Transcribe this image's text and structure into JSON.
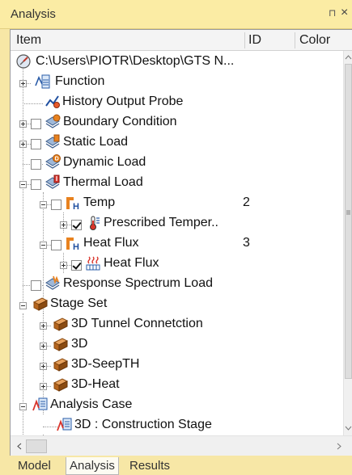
{
  "panel": {
    "title": "Analysis",
    "pin_glyph": "⊓",
    "close_glyph": "×"
  },
  "columns": {
    "item": "Item",
    "id": "ID",
    "color": "Color"
  },
  "tree": [
    {
      "label": "C:\\Users\\PIOTR\\Desktop\\GTS N...",
      "id": "",
      "icon": "project-icon"
    },
    {
      "label": "Function",
      "id": "",
      "icon": "function-icon"
    },
    {
      "label": "History Output Probe",
      "id": "",
      "icon": "history-output-probe-icon"
    },
    {
      "label": "Boundary Condition",
      "id": "",
      "icon": "boundary-condition-icon",
      "checked": false
    },
    {
      "label": "Static Load",
      "id": "",
      "icon": "static-load-icon",
      "checked": false
    },
    {
      "label": "Dynamic Load",
      "id": "",
      "icon": "dynamic-load-icon",
      "checked": false
    },
    {
      "label": "Thermal Load",
      "id": "",
      "icon": "thermal-load-icon",
      "checked": false
    },
    {
      "label": "Temp",
      "id": "2",
      "icon": "load-set-icon",
      "checked": false
    },
    {
      "label": "Prescribed Temper..",
      "id": "",
      "icon": "thermometer-icon",
      "checked": true
    },
    {
      "label": "Heat Flux",
      "id": "3",
      "icon": "load-set-icon",
      "checked": false
    },
    {
      "label": "Heat Flux",
      "id": "",
      "icon": "heat-flux-icon",
      "checked": true
    },
    {
      "label": "Response Spectrum Load",
      "id": "",
      "icon": "response-spectrum-icon",
      "checked": false
    },
    {
      "label": "Stage Set",
      "id": "",
      "icon": "stage-set-icon"
    },
    {
      "label": "3D Tunnel Connetction",
      "id": "",
      "icon": "stage-icon"
    },
    {
      "label": "3D",
      "id": "",
      "icon": "stage-icon"
    },
    {
      "label": "3D-SeepTH",
      "id": "",
      "icon": "stage-icon"
    },
    {
      "label": "3D-Heat",
      "id": "",
      "icon": "stage-icon"
    },
    {
      "label": "Analysis Case",
      "id": "",
      "icon": "analysis-case-icon"
    },
    {
      "label": "3D : Construction Stage",
      "id": "",
      "icon": "analysis-case-item-icon"
    }
  ],
  "tabs": [
    {
      "label": "Model",
      "active": false
    },
    {
      "label": "Analysis",
      "active": true
    },
    {
      "label": "Results",
      "active": false
    }
  ]
}
